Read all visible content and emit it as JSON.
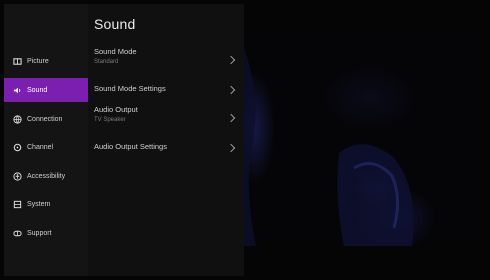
{
  "sidebar": {
    "items": [
      {
        "label": "Picture",
        "icon": "picture-icon"
      },
      {
        "label": "Sound",
        "icon": "sound-icon",
        "active": true
      },
      {
        "label": "Connection",
        "icon": "connection-icon"
      },
      {
        "label": "Channel",
        "icon": "channel-icon"
      },
      {
        "label": "Accessibility",
        "icon": "accessibility-icon"
      },
      {
        "label": "System",
        "icon": "system-icon"
      },
      {
        "label": "Support",
        "icon": "support-icon"
      }
    ],
    "active_color": "#7a1fb0"
  },
  "panel": {
    "title": "Sound",
    "items": [
      {
        "label": "Sound Mode",
        "value": "Standard"
      },
      {
        "label": "Sound Mode Settings",
        "value": ""
      },
      {
        "label": "Audio Output",
        "value": "TV Speaker"
      },
      {
        "label": "Audio Output Settings",
        "value": ""
      }
    ]
  }
}
